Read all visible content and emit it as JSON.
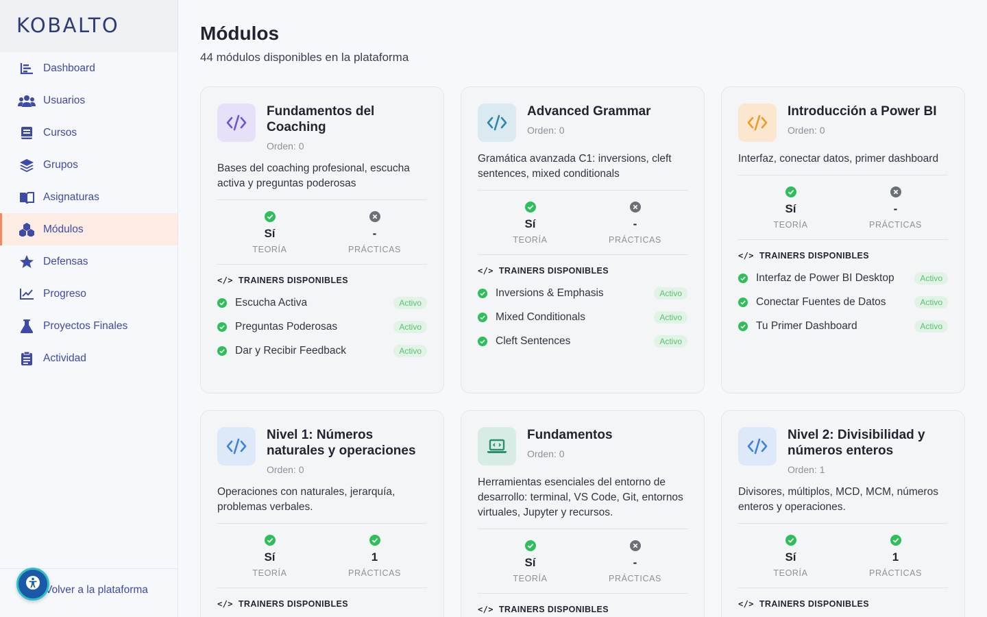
{
  "brand": {
    "logo": "KOBALTO"
  },
  "sidebar": {
    "items": [
      {
        "label": "Dashboard",
        "icon": "chart-bar-icon"
      },
      {
        "label": "Usuarios",
        "icon": "users-icon"
      },
      {
        "label": "Cursos",
        "icon": "book-icon"
      },
      {
        "label": "Grupos",
        "icon": "layers-icon"
      },
      {
        "label": "Asignaturas",
        "icon": "open-book-icon"
      },
      {
        "label": "Módulos",
        "icon": "cubes-icon"
      },
      {
        "label": "Defensas",
        "icon": "star-icon"
      },
      {
        "label": "Progreso",
        "icon": "line-chart-icon"
      },
      {
        "label": "Proyectos Finales",
        "icon": "flask-icon"
      },
      {
        "label": "Actividad",
        "icon": "clipboard-icon"
      }
    ],
    "back_link": "Volver a la plataforma",
    "accessibility_icon": "accessibility-icon"
  },
  "header": {
    "title": "Módulos",
    "subtitle": "44 módulos disponibles en la plataforma"
  },
  "labels": {
    "teoria": "TEORÍA",
    "practicas": "PRÁCTICAS",
    "trainers": "TRAINERS DISPONIBLES",
    "code_glyph": "</>"
  },
  "colors": {
    "accent": "#3d4aa8",
    "active_bg": "#fcece4",
    "active_border": "#f08a5d",
    "check": "#2fbf5a",
    "cross": "#6b6f78"
  },
  "cards": [
    {
      "title": "Fundamentos del Coaching",
      "order": "Orden: 0",
      "desc": "Bases del coaching profesional, escucha activa y preguntas poderosas",
      "teoria": "Sí",
      "practicas": "-",
      "icon": "code-icon",
      "trainers": [
        {
          "name": "Escucha Activa",
          "status": "Activo"
        },
        {
          "name": "Preguntas Poderosas",
          "status": "Activo"
        },
        {
          "name": "Dar y Recibir Feedback",
          "status": "Activo"
        }
      ]
    },
    {
      "title": "Advanced Grammar",
      "order": "Orden: 0",
      "desc": "Gramática avanzada C1: inversions, cleft sentences, mixed conditionals",
      "teoria": "Sí",
      "practicas": "-",
      "icon": "code-icon",
      "trainers": [
        {
          "name": "Inversions & Emphasis",
          "status": "Activo"
        },
        {
          "name": "Mixed Conditionals",
          "status": "Activo"
        },
        {
          "name": "Cleft Sentences",
          "status": "Activo"
        }
      ]
    },
    {
      "title": "Introducción a Power BI",
      "order": "Orden: 0",
      "desc": "Interfaz, conectar datos, primer dashboard",
      "teoria": "Sí",
      "practicas": "-",
      "icon": "code-icon",
      "trainers": [
        {
          "name": "Interfaz de Power BI Desktop",
          "status": "Activo"
        },
        {
          "name": "Conectar Fuentes de Datos",
          "status": "Activo"
        },
        {
          "name": "Tu Primer Dashboard",
          "status": "Activo"
        }
      ]
    },
    {
      "title": "Nivel 1: Números naturales y operaciones",
      "order": "Orden: 0",
      "desc": "Operaciones con naturales, jerarquía, problemas verbales.",
      "teoria": "Sí",
      "practicas": "1",
      "icon": "code-icon",
      "trainers": []
    },
    {
      "title": "Fundamentos",
      "order": "Orden: 0",
      "desc": "Herramientas esenciales del entorno de desarrollo: terminal, VS Code, Git, entornos virtuales, Jupyter y recursos.",
      "teoria": "Sí",
      "practicas": "-",
      "icon": "laptop-code-icon",
      "trainers": []
    },
    {
      "title": "Nivel 2: Divisibilidad y números enteros",
      "order": "Orden: 1",
      "desc": "Divisores, múltiplos, MCD, MCM, números enteros y operaciones.",
      "teoria": "Sí",
      "practicas": "1",
      "icon": "code-icon",
      "trainers": []
    }
  ]
}
